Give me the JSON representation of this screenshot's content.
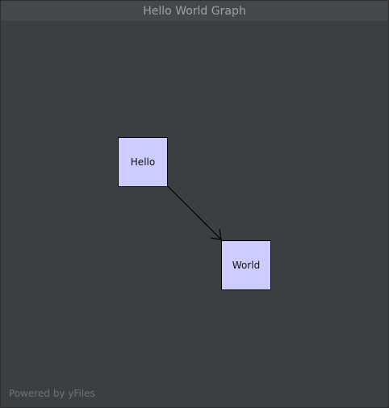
{
  "window": {
    "title": "Hello World Graph"
  },
  "graph": {
    "nodes": [
      {
        "id": "hello",
        "label": "Hello"
      },
      {
        "id": "world",
        "label": "World"
      }
    ],
    "edges": [
      {
        "source": "hello",
        "target": "world",
        "arrow": "open"
      }
    ]
  },
  "footer": {
    "powered_by": "Powered by yFiles"
  },
  "colors": {
    "background": "#3c3f41",
    "titlebar": "#45484a",
    "node_fill": "#ccccff",
    "node_stroke": "#000000",
    "edge": "#000000"
  }
}
